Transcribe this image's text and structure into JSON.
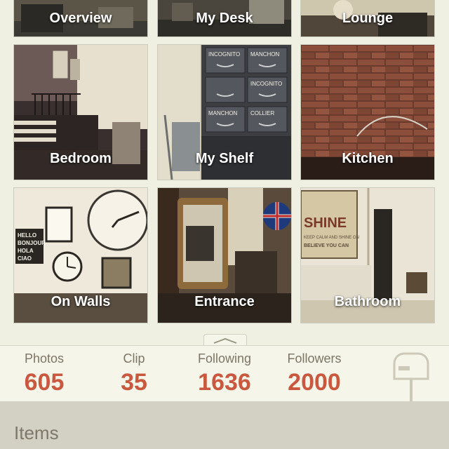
{
  "tiles_top": [
    {
      "label": "Overview"
    },
    {
      "label": "My Desk"
    },
    {
      "label": "Lounge"
    }
  ],
  "tiles": [
    {
      "label": "Bedroom"
    },
    {
      "label": "My Shelf"
    },
    {
      "label": "Kitchen"
    },
    {
      "label": "On Walls"
    },
    {
      "label": "Entrance"
    },
    {
      "label": "Bathroom"
    }
  ],
  "stats": {
    "photos": {
      "label": "Photos",
      "value": "605"
    },
    "clip": {
      "label": "Clip",
      "value": "35"
    },
    "following": {
      "label": "Following",
      "value": "1636"
    },
    "followers": {
      "label": "Followers",
      "value": "2000"
    }
  },
  "drawer_labels": [
    "INCOGNITO",
    "MANCHON",
    "INCOGNITO",
    "MANCHON",
    "COLLIER"
  ],
  "signs": {
    "greeting": [
      "HELLO",
      "BONJOUR",
      "HOLA",
      "CIAO"
    ],
    "shine": "SHINE",
    "keep_calm": "KEEP CALM AND SHINE ON",
    "believe": "BELIEVE YOU CAN"
  },
  "items": {
    "title": "Items"
  },
  "colors": {
    "accent": "#c9583f",
    "label": "#7b7565",
    "bar": "#f6f5ea"
  },
  "icons": {
    "mailbox": "mailbox-icon",
    "pull_tab": "chevron-up-icon"
  }
}
